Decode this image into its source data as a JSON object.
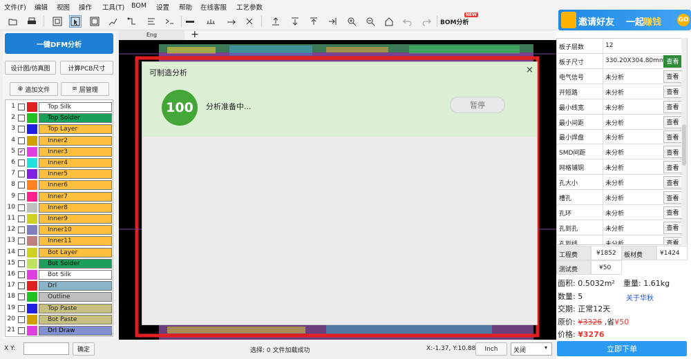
{
  "menu": [
    "文件(F)",
    "编辑",
    "视图",
    "操作",
    "工具(T)",
    "BOM",
    "设置",
    "帮助",
    "在线客服",
    "工艺参数"
  ],
  "toolbar": {
    "bom_label": "BOM分析",
    "bom_badge": "NEW",
    "icons": [
      "open-icon",
      "print-icon",
      "select-icon",
      "pointer-icon",
      "select-area-icon",
      "route-icon",
      "trace-icon",
      "dimension-icon",
      "line-icon",
      "layer-top-icon",
      "layer-down-icon",
      "align-left-icon",
      "align-right-icon",
      "zoom-in-icon",
      "zoom-out-icon",
      "home-icon",
      "undo-icon",
      "redo-icon"
    ]
  },
  "banner": {
    "text1": "邀请好友",
    "text_mid": "一起",
    "text2": "赚钱",
    "go": "GO"
  },
  "left": {
    "dfm_button": "一键DFM分析",
    "design_view": "设计图/仿真图",
    "calc_size": "计算PCB尺寸",
    "add_file": "追加文件",
    "layer_mgmt": "层管理",
    "layers": [
      {
        "num": "1",
        "name": "Top Silk",
        "color": "#e02020",
        "bg": "#ffffff",
        "checked": false
      },
      {
        "num": "2",
        "name": "Top Solder",
        "color": "#20c020",
        "bg": "#1aa05a",
        "checked": false
      },
      {
        "num": "3",
        "name": "Top Layer",
        "color": "#2020e0",
        "bg": "#ffc040",
        "checked": false
      },
      {
        "num": "4",
        "name": "Inner2",
        "color": "#d0a000",
        "bg": "#ffc040",
        "checked": false
      },
      {
        "num": "5",
        "name": "Inner3",
        "color": "#e040e0",
        "bg": "#ffc040",
        "checked": true
      },
      {
        "num": "6",
        "name": "Inner4",
        "color": "#20e0e0",
        "bg": "#ffc040",
        "checked": false
      },
      {
        "num": "7",
        "name": "Inner5",
        "color": "#8020e0",
        "bg": "#ffc040",
        "checked": false
      },
      {
        "num": "8",
        "name": "Inner6",
        "color": "#ff8020",
        "bg": "#ffc040",
        "checked": false
      },
      {
        "num": "9",
        "name": "Inner7",
        "color": "#ff2090",
        "bg": "#ffc040",
        "checked": false
      },
      {
        "num": "10",
        "name": "Inner8",
        "color": "#c0c0c0",
        "bg": "#ffc040",
        "checked": false
      },
      {
        "num": "11",
        "name": "Inner9",
        "color": "#d0d020",
        "bg": "#ffc040",
        "checked": false
      },
      {
        "num": "12",
        "name": "Inner10",
        "color": "#8080c0",
        "bg": "#ffc040",
        "checked": false
      },
      {
        "num": "13",
        "name": "Inner11",
        "color": "#c08080",
        "bg": "#ffc040",
        "checked": false
      },
      {
        "num": "14",
        "name": "Bot Layer",
        "color": "#d0d020",
        "bg": "#ffc040",
        "checked": false
      },
      {
        "num": "15",
        "name": "Bot Solder",
        "color": "#c0e060",
        "bg": "#1aa05a",
        "checked": false
      },
      {
        "num": "16",
        "name": "Bot Silk",
        "color": "#e040e0",
        "bg": "#ffffff",
        "checked": false
      },
      {
        "num": "17",
        "name": "Drl",
        "color": "#e02020",
        "bg": "#8ab4c8",
        "checked": false
      },
      {
        "num": "18",
        "name": "Outline",
        "color": "#20c020",
        "bg": "#c0c0c0",
        "checked": false
      },
      {
        "num": "19",
        "name": "Top Paste",
        "color": "#2020e0",
        "bg": "#c8c080",
        "checked": false
      },
      {
        "num": "20",
        "name": "Bot Paste",
        "color": "#d0a000",
        "bg": "#c8c080",
        "checked": false
      },
      {
        "num": "21",
        "name": "Drl Draw",
        "color": "#e040e0",
        "bg": "#8090d0",
        "checked": false
      }
    ]
  },
  "status": {
    "xy_label": "X Y:",
    "confirm": "确定",
    "selection": "选择: 0  文件加载成功",
    "coords": "X:-1.37, Y:10.88",
    "unit": "Inch",
    "mode": "关闭"
  },
  "tab": {
    "name": "Eng",
    "add": "+"
  },
  "dialog": {
    "title": "可制造分析",
    "progress": "100",
    "status": "分析准备中...",
    "pause": "暂停",
    "close": "×"
  },
  "props": [
    {
      "label": "板子层数",
      "value": "12",
      "btn": ""
    },
    {
      "label": "板子尺寸",
      "value": "330.20X304.80mm",
      "btn": "查看",
      "green": true
    },
    {
      "label": "电气信号",
      "value": "未分析",
      "btn": "查看"
    },
    {
      "label": "开短路",
      "value": "未分析",
      "btn": "查看"
    },
    {
      "label": "最小线宽",
      "value": "未分析",
      "btn": "查看"
    },
    {
      "label": "最小间距",
      "value": "未分析",
      "btn": "查看"
    },
    {
      "label": "最小焊盘",
      "value": "未分析",
      "btn": "查看"
    },
    {
      "label": "SMD间距",
      "value": "未分析",
      "btn": "查看"
    },
    {
      "label": "网格铺铜",
      "value": "未分析",
      "btn": "查看"
    },
    {
      "label": "孔大小",
      "value": "未分析",
      "btn": "查看"
    },
    {
      "label": "槽孔",
      "value": "未分析",
      "btn": "查看"
    },
    {
      "label": "孔环",
      "value": "未分析",
      "btn": "查看"
    },
    {
      "label": "孔到孔",
      "value": "未分析",
      "btn": "查看"
    },
    {
      "label": "孔到线",
      "value": "未分析",
      "btn": "查看"
    }
  ],
  "fees": {
    "eng_label": "工程费",
    "eng_value": "¥1852",
    "board_label": "板材费",
    "board_value": "¥1424",
    "test_label": "测试费",
    "test_value": "¥50"
  },
  "summary": {
    "area": "面积: 0.5032m²",
    "weight": "重量: 1.61kg",
    "qty": "数量: 5",
    "about": "关于华秋",
    "delivery": "交期: 正常12天",
    "orig_label": "原价: ",
    "orig_price": "¥3326",
    "save_label": " ,省",
    "save_value": "¥50",
    "price_label": "价格: ",
    "price": "¥3276",
    "order": "立即下单"
  }
}
